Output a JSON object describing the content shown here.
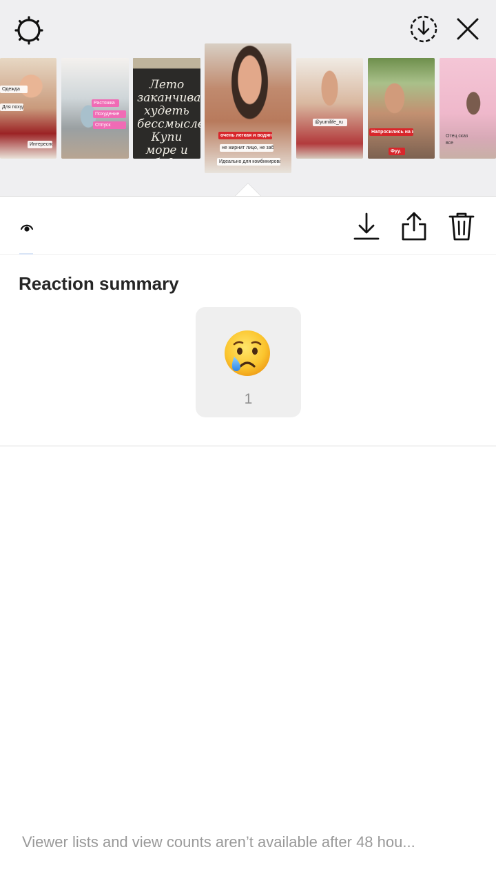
{
  "header": {
    "settings_icon": "gear-icon",
    "save_story_icon": "download-circle-icon",
    "close_icon": "close-icon"
  },
  "thumbnails": [
    {
      "labels": [
        "Одежда",
        "Для похудения",
        "Интересное"
      ]
    },
    {
      "labels": [
        "Растяжка",
        "Похудение",
        "Отпуск"
      ]
    },
    {
      "board_text": "Лето заканчивается худеть бессмысленно Купи море и будь счастлив"
    },
    {
      "labels": [
        "очень легкая и водянистая текстура",
        "не жирнит лицо, не забивает поры",
        "Идеально для комбинированной и жирной кожи"
      ]
    },
    {
      "labels": [
        "@yumilife_ru"
      ]
    },
    {
      "labels": [
        "Напросились на жару?!",
        "Фуу."
      ]
    },
    {
      "labels": [
        "Отец сказ",
        "все"
      ]
    }
  ],
  "toolbar": {
    "views_icon": "eye-icon",
    "download_icon": "download-icon",
    "share_icon": "share-icon",
    "delete_icon": "trash-icon"
  },
  "reaction_summary": {
    "title": "Reaction summary",
    "reactions": [
      {
        "emoji_name": "crying-face",
        "count": "1"
      }
    ]
  },
  "footer": {
    "note": "Viewer lists and view counts aren’t available after 48 hou..."
  }
}
